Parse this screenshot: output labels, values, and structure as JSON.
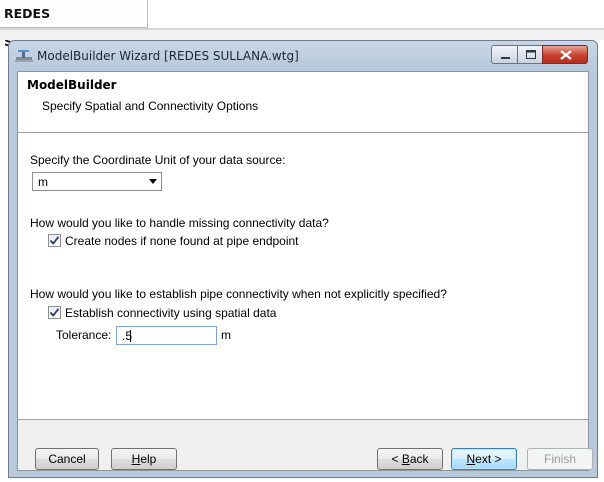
{
  "document_tab": {
    "label": "REDES SULLANA.wtg"
  },
  "window": {
    "title": "ModelBuilder Wizard [REDES SULLANA.wtg]",
    "controls": {
      "minimize": "minimize",
      "maximize": "maximize",
      "close": "close"
    }
  },
  "header": {
    "title": "ModelBuilder",
    "subtitle": "Specify Spatial and Connectivity Options"
  },
  "coordinate_unit": {
    "question": "Specify the Coordinate Unit of your data source:",
    "selected": "m"
  },
  "missing_connectivity": {
    "question": "How would you like to handle missing connectivity data?",
    "checkbox_label": "Create nodes if none found at pipe endpoint",
    "checked": true
  },
  "pipe_connectivity": {
    "question": "How would you like to establish pipe connectivity when not explicitly specified?",
    "checkbox_label": "Establish connectivity using spatial data",
    "checked": true,
    "tolerance_label": "Tolerance:",
    "tolerance_value": ".5",
    "tolerance_unit": "m"
  },
  "buttons": {
    "cancel": "Cancel",
    "help_mnemonic": "H",
    "help_rest": "elp",
    "back_prefix": "< ",
    "back_mnemonic": "B",
    "back_rest": "ack",
    "next_mnemonic": "N",
    "next_rest": "ext >",
    "finish": "Finish"
  }
}
